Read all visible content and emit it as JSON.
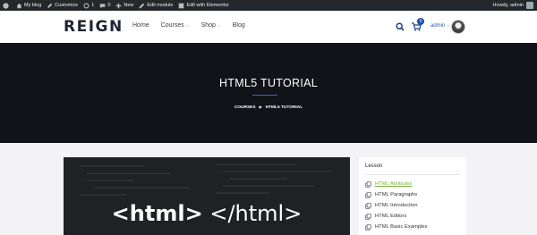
{
  "adminbar": {
    "site": "My blog",
    "customize": "Customize",
    "updates": "1",
    "comments": "0",
    "new": "New",
    "edit_module": "Edit module",
    "edit_elementor": "Edit with Elementor",
    "greeting": "Howdy, admin"
  },
  "header": {
    "logo": "REIGN",
    "nav": [
      {
        "label": "Home"
      },
      {
        "label": "Courses"
      },
      {
        "label": "Shop"
      },
      {
        "label": "Blog"
      }
    ],
    "cart_count": "0",
    "user": "admin"
  },
  "banner": {
    "title": "HTML5 TUTORIAL",
    "breadcrumb": [
      "COURSES",
      "HTML5 TUTORIAL"
    ]
  },
  "hero": {
    "code_open": "<html>",
    "code_close": "</html>"
  },
  "lessons": {
    "heading": "Lesson",
    "items": [
      {
        "label": "HTML Attributes"
      },
      {
        "label": "HTML Paragraphs"
      },
      {
        "label": "HTML Introduction"
      },
      {
        "label": "HTML Editors"
      },
      {
        "label": "HTML Basic Examples"
      }
    ]
  },
  "colors": {
    "accent": "#1d4fa6",
    "active_lesson": "#7cb342",
    "banner_bg": "#111318",
    "adminbar_bg": "#23282d"
  }
}
